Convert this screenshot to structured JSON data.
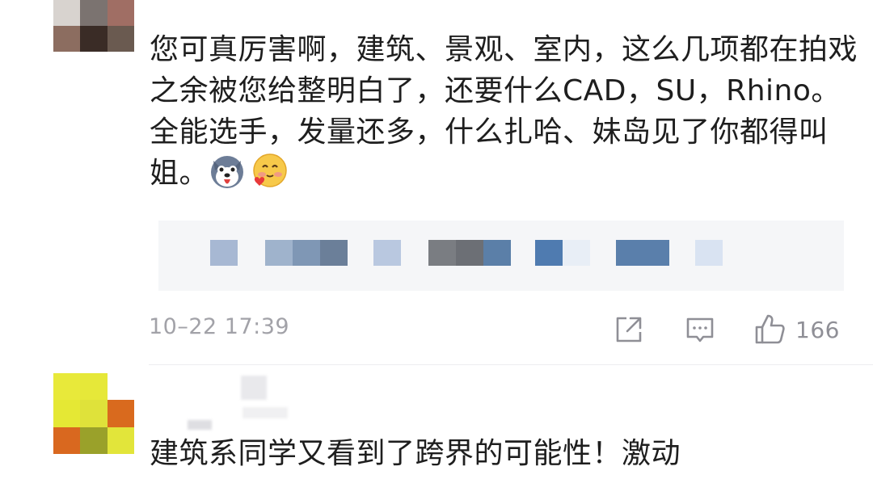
{
  "comments": [
    {
      "text_parts": [
        "您可真厉害啊，建筑、景观、室内，这么几项都在拍戏之余被您给整明白了，还要什么CAD，SU，Rhino。全能选手，发量还多，什么扎哈、妹岛见了你都得叫姐。"
      ],
      "emojis": [
        "husky-dog-emoji",
        "blushing-heart-emoji"
      ],
      "link_preview": "censored",
      "timestamp": "10–22 17:39",
      "actions": {
        "share_icon": "share-icon",
        "comment_icon": "comment-icon",
        "like_icon": "thumbs-up-icon",
        "like_count": "166"
      },
      "avatar_colors": [
        "#d8d3cf",
        "#7b7370",
        "#a06e64",
        "#8c6d60",
        "#4a3b34",
        "#6a5a50"
      ]
    },
    {
      "text": "建筑系同学又看到了跨界的可能性！激动",
      "avatar_colors": [
        "#e8e93a",
        "#e6e839",
        "#ffffff",
        "#e5e834",
        "#dfe23a",
        "#d96a1e",
        "#d9681f",
        "#9aa12a",
        "#e2e53a"
      ]
    }
  ],
  "theme": {
    "text": "#1e1e1e",
    "meta": "#a2a2a8",
    "link_bg": "#f5f6f8"
  }
}
